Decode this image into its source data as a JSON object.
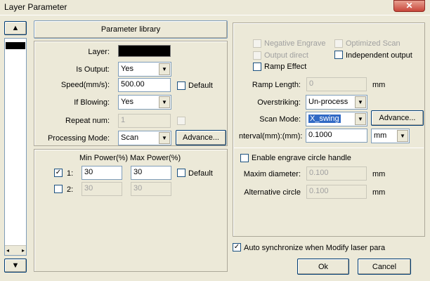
{
  "window": {
    "title": "Layer Parameter",
    "close_glyph": "✕"
  },
  "left_strip": {
    "up_glyph": "▲",
    "down_glyph": "▼",
    "scroll_left": "◂",
    "scroll_right": "▸"
  },
  "left": {
    "param_library": "Parameter library",
    "layer_label": "Layer:",
    "layer_color": "#000000",
    "is_output_label": "Is Output:",
    "is_output_value": "Yes",
    "speed_label": "Speed(mm/s):",
    "speed_value": "500.00",
    "default_label": "Default",
    "if_blowing_label": "If Blowing:",
    "if_blowing_value": "Yes",
    "repeat_label": "Repeat num:",
    "repeat_value": "1",
    "processing_mode_label": "Processing Mode:",
    "processing_mode_value": "Scan",
    "advance_label": "Advance..."
  },
  "power": {
    "min_header": "Min Power(%)",
    "max_header": "Max Power(%)",
    "row1_label": "1:",
    "row1_checked": true,
    "row1_min": "30",
    "row1_max": "30",
    "default_label": "Default",
    "row2_label": "2:",
    "row2_checked": false,
    "row2_min": "30",
    "row2_max": "30"
  },
  "right": {
    "negative_engrave": "Negative Engrave",
    "optimized_scan": "Optimized Scan",
    "output_direct": "Output direct",
    "independent_output": "Independent output",
    "ramp_effect": "Ramp Effect",
    "ramp_length_label": "Ramp Length:",
    "ramp_length_value": "0",
    "unit_mm": "mm",
    "overstriking_label": "Overstriking:",
    "overstriking_value": "Un-process",
    "scan_mode_label": "Scan Mode:",
    "scan_mode_value": "X_swing",
    "advance_label": "Advance...",
    "interval_label": "nterval(mm):(mm):",
    "interval_value": "0.1000",
    "interval_unit": "mm",
    "enable_circle": "Enable engrave circle handle",
    "maxim_diameter_label": "Maxim diameter:",
    "maxim_diameter_value": "0.100",
    "alt_circle_label": "Alternative circle",
    "alt_circle_value": "0.100"
  },
  "footer": {
    "auto_sync": "Auto synchronize when Modify laser para",
    "auto_sync_checked": true,
    "ok": "Ok",
    "cancel": "Cancel",
    "check_glyph": "✓"
  }
}
